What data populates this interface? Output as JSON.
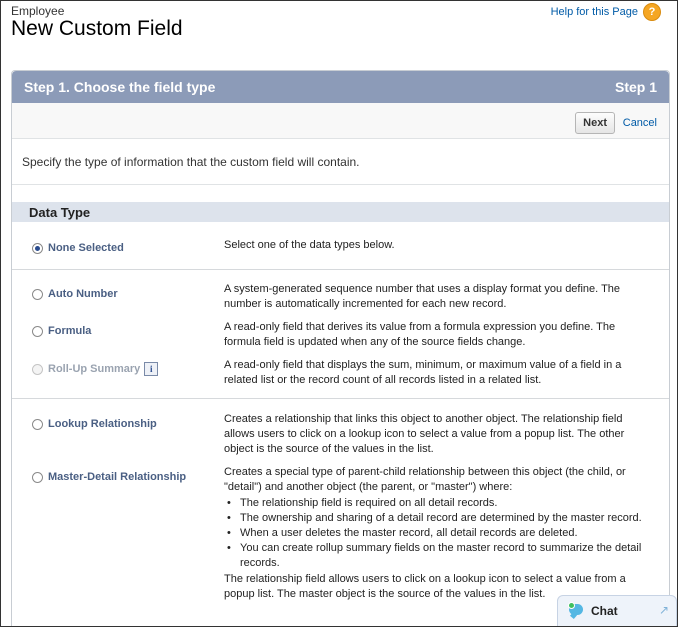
{
  "header": {
    "object_label": "Employee",
    "title": "New Custom Field",
    "help_link": "Help for this Page",
    "help_icon": "question-icon"
  },
  "step": {
    "title": "Step 1. Choose the field type",
    "step_label": "Step 1"
  },
  "buttons": {
    "next": "Next",
    "cancel": "Cancel"
  },
  "instructions": "Specify the type of information that the custom field will contain.",
  "section": {
    "title": "Data Type"
  },
  "options": {
    "none": {
      "label": "None Selected",
      "desc": "Select one of the data types below.",
      "selected": true
    },
    "auto_number": {
      "label": "Auto Number",
      "desc": "A system-generated sequence number that uses a display format you define. The number is automatically incremented for each new record."
    },
    "formula": {
      "label": "Formula",
      "desc": "A read-only field that derives its value from a formula expression you define. The formula field is updated when any of the source fields change."
    },
    "rollup": {
      "label": "Roll-Up Summary",
      "desc": "A read-only field that displays the sum, minimum, or maximum value of a field in a related list or the record count of all records listed in a related list.",
      "disabled": true,
      "info": "i"
    },
    "lookup": {
      "label": "Lookup Relationship",
      "desc": "Creates a relationship that links this object to another object. The relationship field allows users to click on a lookup icon to select a value from a popup list. The other object is the source of the values in the list."
    },
    "master_detail": {
      "label": "Master-Detail Relationship",
      "desc_intro": "Creates a special type of parent-child relationship between this object (the child, or \"detail\") and another object (the parent, or \"master\") where:",
      "bullets": [
        "The relationship field is required on all detail records.",
        "The ownership and sharing of a detail record are determined by the master record.",
        "When a user deletes the master record, all detail records are deleted.",
        "You can create rollup summary fields on the master record to summarize the detail records."
      ],
      "desc_outro": "The relationship field allows users to click on a lookup icon to select a value from a popup list. The master object is the source of the values in the list."
    }
  },
  "chat": {
    "label": "Chat",
    "icon": "chat-bubble-icon",
    "expand_icon": "expand-arrow-icon"
  },
  "colors": {
    "header_bar": "#8c9bb8",
    "section_bar": "#dde3ec",
    "link": "#015ba7",
    "option_label": "#4a5f83"
  }
}
